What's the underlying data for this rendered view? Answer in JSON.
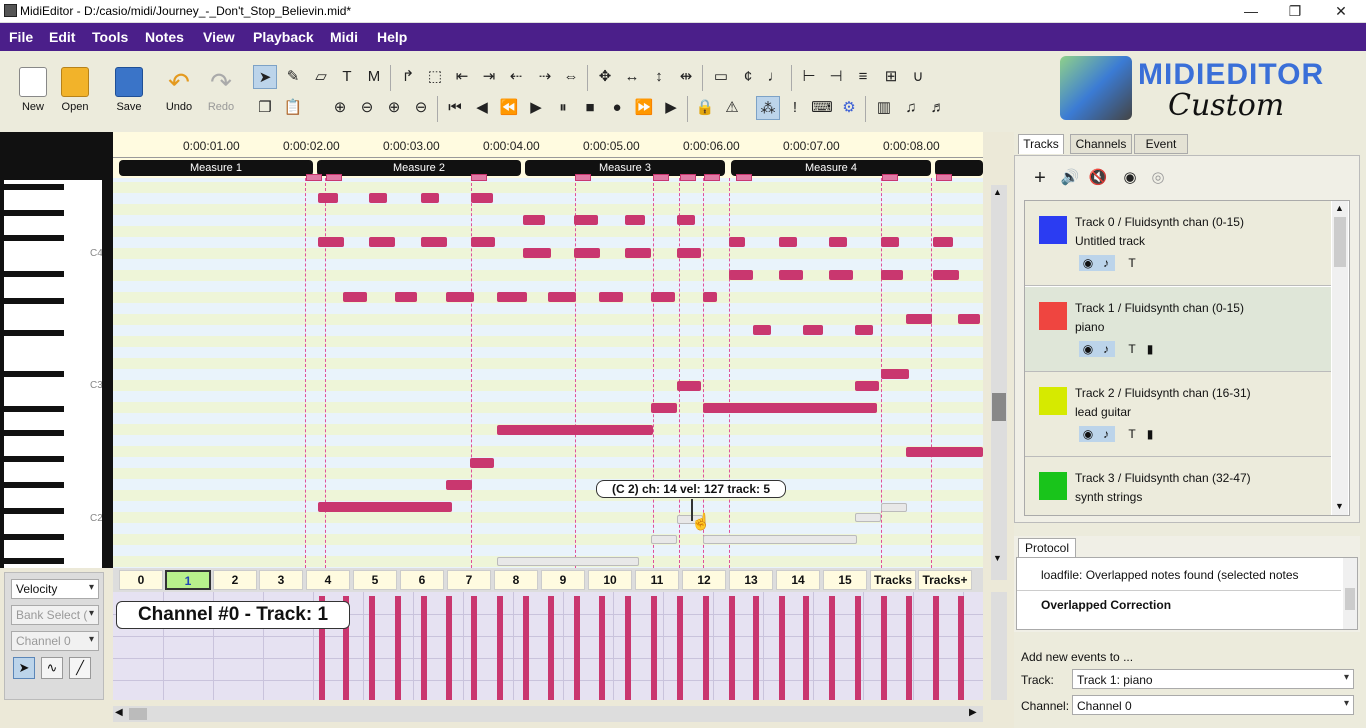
{
  "window": {
    "title": "MidiEditor - D:/casio/midi/Journey_-_Don't_Stop_Believin.mid*",
    "minimize": "—",
    "restore": "❐",
    "close": "✕"
  },
  "menu": [
    "File",
    "Edit",
    "Tools",
    "Notes",
    "View",
    "Playback",
    "Midi",
    "Help"
  ],
  "toolbar": {
    "new": "New",
    "open": "Open",
    "save": "Save",
    "undo": "Undo",
    "redo": "Redo"
  },
  "logo": {
    "line1": "MIDIEDITOR",
    "line2": "Custom"
  },
  "timeline": [
    "0:00:01.00",
    "0:00:02.00",
    "0:00:03.00",
    "0:00:04.00",
    "0:00:05.00",
    "0:00:06.00",
    "0:00:07.00",
    "0:00:08.00"
  ],
  "measures": [
    "Measure 1",
    "Measure 2",
    "Measure 3",
    "Measure 4"
  ],
  "key_labels": [
    "C4",
    "C3",
    "C2"
  ],
  "tooltip": "(C 2) ch: 14 vel: 127 track: 5",
  "channels": [
    "0",
    "1",
    "2",
    "3",
    "4",
    "5",
    "6",
    "7",
    "8",
    "9",
    "10",
    "11",
    "12",
    "13",
    "14",
    "15",
    "Tracks",
    "Tracks+"
  ],
  "selected_channel": "1",
  "velocity_panel": {
    "mode": "Velocity",
    "bank": "Bank Select (",
    "channel": "Channel 0"
  },
  "channel_label": "Channel #0 - Track: 1",
  "right_tabs": [
    "Tracks",
    "Channels",
    "Event"
  ],
  "tracks": [
    {
      "title": "Track 0 / Fluidsynth chan (0-15)",
      "name": "Untitled track",
      "color": "#2b3cf2"
    },
    {
      "title": "Track 1 / Fluidsynth chan (0-15)",
      "name": "piano",
      "color": "#ef4540"
    },
    {
      "title": "Track 2 / Fluidsynth chan (16-31)",
      "name": "lead guitar",
      "color": "#d6ea00"
    },
    {
      "title": "Track 3 / Fluidsynth chan (32-47)",
      "name": "synth strings",
      "color": "#19c41b"
    }
  ],
  "protocol": {
    "tab": "Protocol",
    "line1": "loadfile: Overlapped notes found (selected notes",
    "line2": "Overlapped Correction"
  },
  "add_events": {
    "title": "Add new events to ...",
    "track_label": "Track:",
    "track_value": "Track 1: piano",
    "channel_label": "Channel:",
    "channel_value": "Channel 0"
  }
}
